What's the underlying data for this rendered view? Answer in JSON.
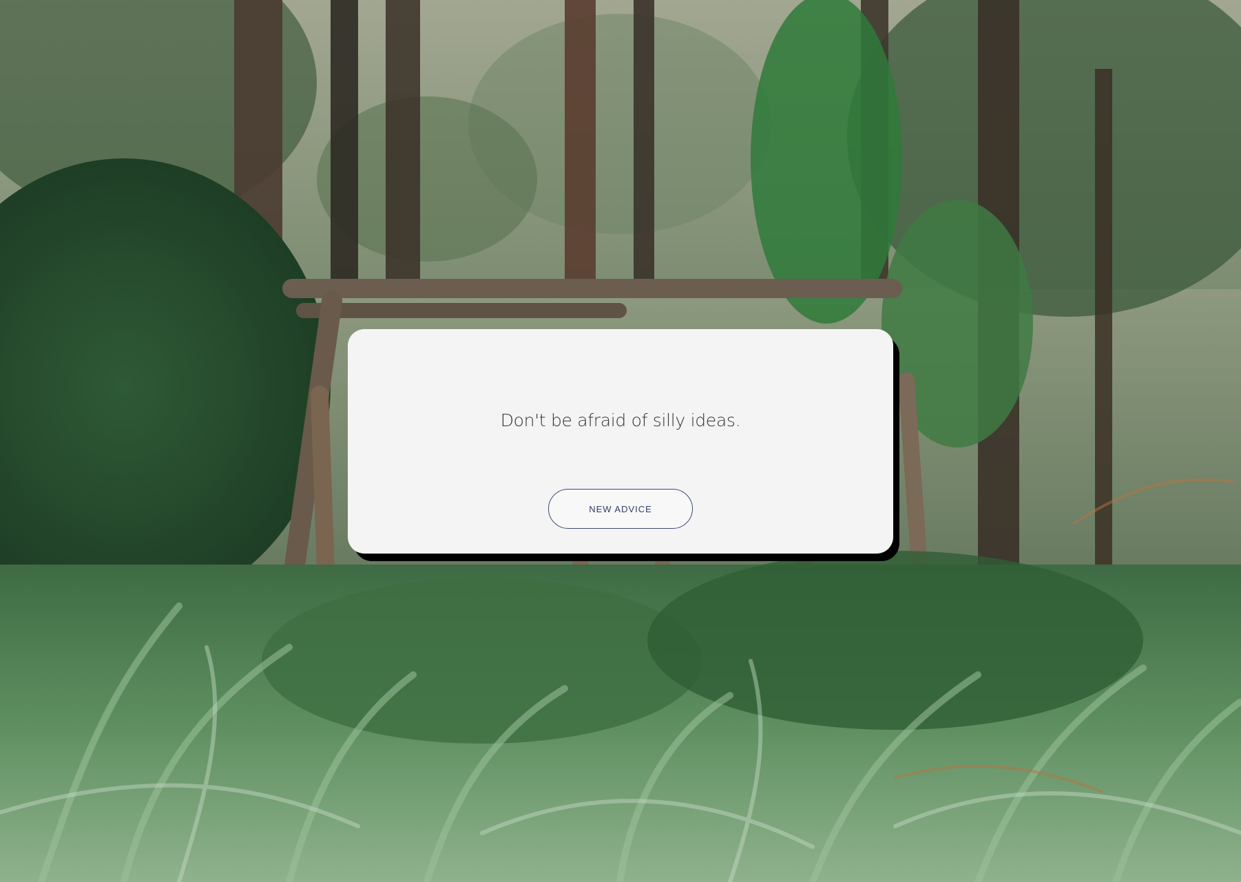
{
  "advice": {
    "text": "Don't be afraid of silly ideas."
  },
  "actions": {
    "new_advice_label": "NEW ADVICE"
  },
  "colors": {
    "card_background": "#f4f4f4",
    "card_shadow": "#000000",
    "button_border": "#3b4b73",
    "text": "#333333"
  },
  "background": {
    "description_icon": "forest-photo"
  }
}
